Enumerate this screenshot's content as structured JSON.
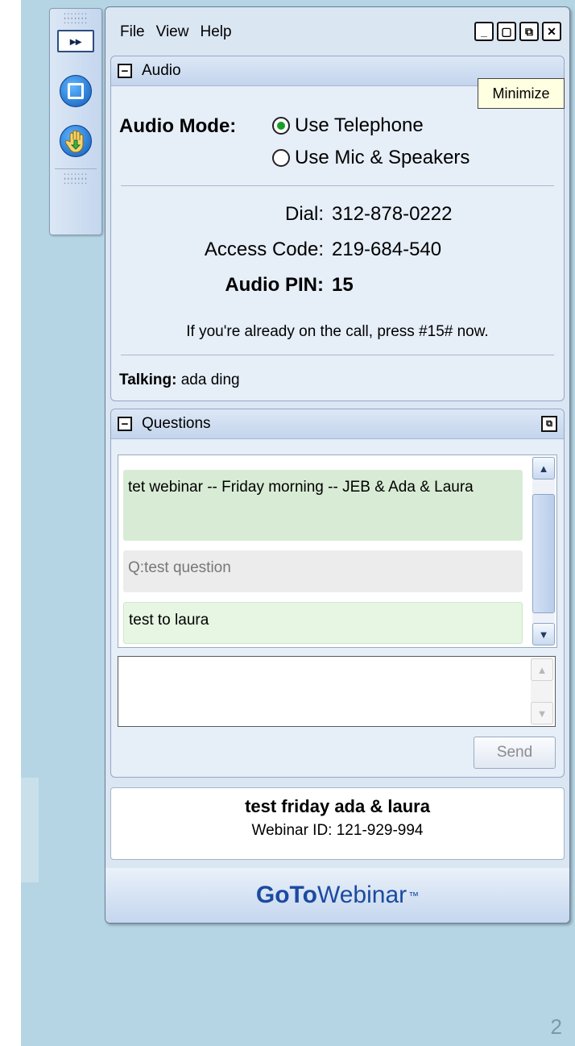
{
  "page_number": "2",
  "grab_tab": {
    "expand_symbol": "▸▸"
  },
  "menu": {
    "file": "File",
    "view": "View",
    "help": "Help"
  },
  "window_controls": {
    "minimize": "_",
    "restore": "▢",
    "popout": "⧉",
    "close": "✕"
  },
  "tooltip": "Minimize",
  "audio": {
    "title": "Audio",
    "mode_label": "Audio Mode:",
    "option_telephone": "Use Telephone",
    "option_mic": "Use Mic & Speakers",
    "selected": "telephone",
    "dial_label": "Dial:",
    "dial_value": "312-878-0222",
    "access_label": "Access Code:",
    "access_value": "219-684-540",
    "pin_label": "Audio PIN:",
    "pin_value": "15",
    "note": "If you're already on the call, press #15# now.",
    "talking_label": "Talking:",
    "talking_value": "ada ding"
  },
  "questions": {
    "title": "Questions",
    "items": [
      "tet webinar -- Friday morning -- JEB & Ada & Laura",
      "Q:test question",
      "test to laura"
    ],
    "send_label": "Send"
  },
  "webinar": {
    "title": "test friday ada & laura",
    "id_line": "Webinar ID: 121-929-994"
  },
  "brand": {
    "part1": "GoTo",
    "part2": "Webinar",
    "tm": "™"
  },
  "colors": {
    "slide_bg": "#b5d5e4",
    "window_bg": "#dbe6f3",
    "brand_blue": "#1c4aa0",
    "radio_selected": "#1a9e2a"
  }
}
